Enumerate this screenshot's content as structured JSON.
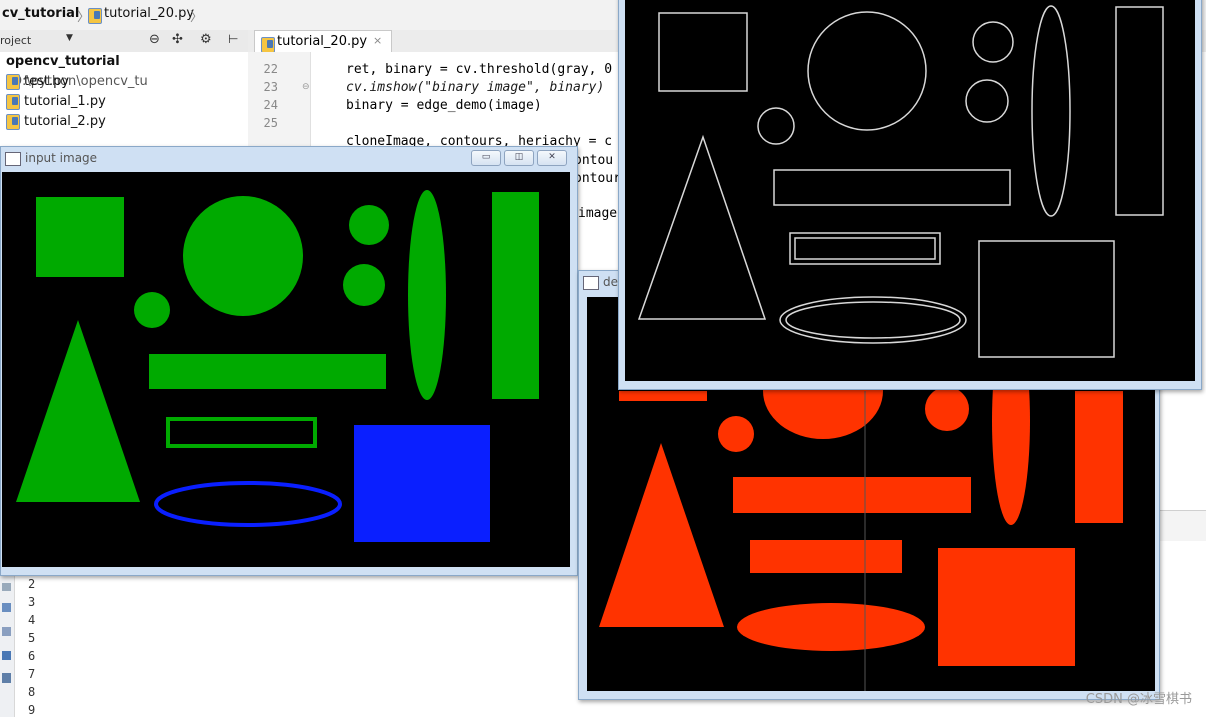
{
  "ide": {
    "breadcrumb": [
      "cv_tutorial",
      "tutorial_20.py"
    ],
    "project_label": "roject",
    "editor_tab": "tutorial_20.py",
    "tree": {
      "root_name": "opencv_tutorial",
      "root_path": "D:\\python\\opencv_tu",
      "files": [
        "test.py",
        "tutorial_1.py",
        "tutorial_2.py"
      ]
    },
    "code_lines": [
      {
        "num": "22",
        "text": "ret, binary = cv.threshold(gray, 0"
      },
      {
        "num": "23",
        "text": "cv.imshow(\"binary image\", binary)"
      },
      {
        "num": "24",
        "text": "binary = edge_demo(image)"
      },
      {
        "num": "25",
        "text": ""
      }
    ],
    "code_partial": [
      "cloneImage, contours, heriachy = c",
      "ontou",
      "ontour",
      "image"
    ],
    "run_lines": [
      "2",
      "3",
      "4",
      "5",
      "6",
      "7",
      "8",
      "9"
    ]
  },
  "windows": {
    "input": {
      "title": "input image"
    },
    "detect": {
      "title": "de"
    }
  },
  "colors": {
    "green": "#00aa00",
    "blue": "#0a1fff",
    "red": "#ff3300",
    "edge": "#d8d8d8"
  },
  "watermark": "CSDN @冰雪棋书"
}
